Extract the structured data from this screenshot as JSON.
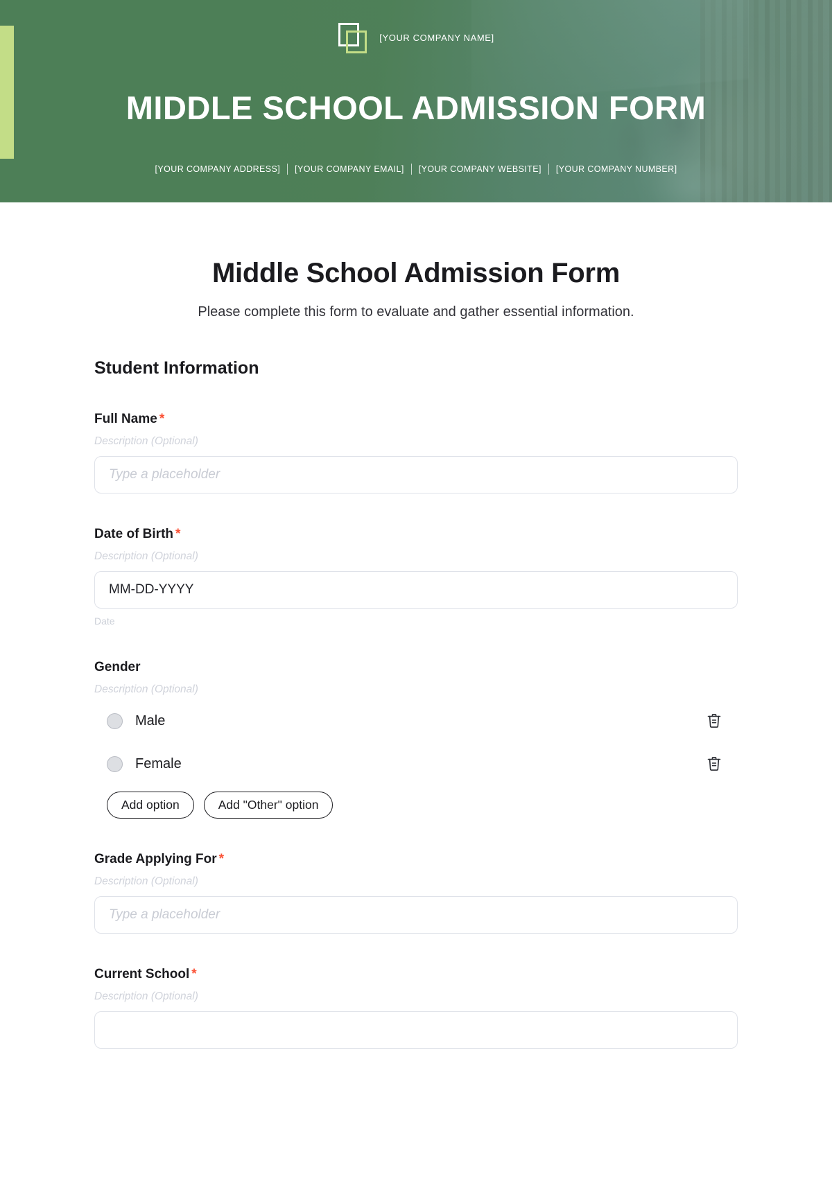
{
  "banner": {
    "company_name": "[YOUR COMPANY NAME]",
    "title": "MIDDLE SCHOOL ADMISSION FORM",
    "contacts": [
      "[YOUR COMPANY ADDRESS]",
      "[YOUR COMPANY EMAIL]",
      "[YOUR COMPANY WEBSITE]",
      "[YOUR COMPANY NUMBER]"
    ],
    "logo_icon": "overlapping-squares-logo-icon",
    "accent_color": "#c3dd87",
    "background_color": "#4d7f57"
  },
  "form": {
    "title": "Middle School Admission Form",
    "subtitle": "Please complete this form to evaluate and gather essential information.",
    "section_title": "Student Information",
    "required_marker": "*",
    "required_color": "#fb5236",
    "fields": [
      {
        "label": "Full Name",
        "required": true,
        "description": "Description (Optional)",
        "placeholder": "Type a placeholder"
      },
      {
        "label": "Date of Birth",
        "required": true,
        "description": "Description (Optional)",
        "value": "MM-DD-YYYY",
        "helper": "Date"
      },
      {
        "label": "Gender",
        "required": false,
        "description": "Description (Optional)",
        "options": [
          "Male",
          "Female"
        ],
        "delete_icon": "trash-icon",
        "add_option_label": "Add option",
        "add_other_option_label": "Add \"Other\" option"
      },
      {
        "label": "Grade Applying For",
        "required": true,
        "description": "Description (Optional)",
        "placeholder": "Type a placeholder"
      },
      {
        "label": "Current School",
        "required": true,
        "description": "Description (Optional)"
      }
    ]
  }
}
